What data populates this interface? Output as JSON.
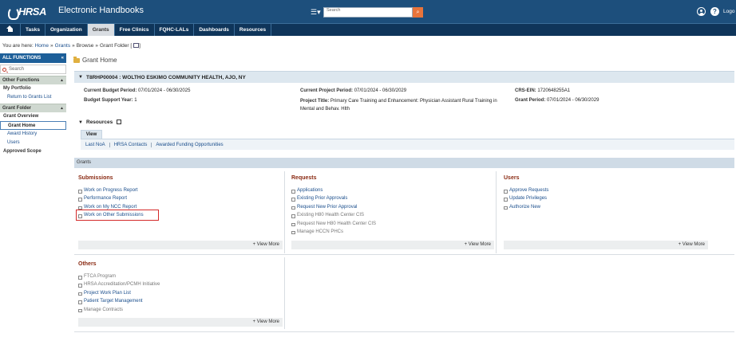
{
  "header": {
    "logo_text": "HRSA",
    "app_title": "Electronic Handbooks",
    "search_placeholder": "Search",
    "logout_label": "Logo"
  },
  "nav": {
    "items": [
      {
        "label": "Tasks"
      },
      {
        "label": "Organization"
      },
      {
        "label": "Grants",
        "active": true
      },
      {
        "label": "Free Clinics"
      },
      {
        "label": "FQHC-LALs"
      },
      {
        "label": "Dashboards"
      },
      {
        "label": "Resources"
      }
    ]
  },
  "breadcrumb": {
    "prefix": "You are here:",
    "items": [
      "Home",
      "Grants",
      "Browse",
      "Grant Folder"
    ],
    "open_bracket": "[",
    "close_bracket": "]"
  },
  "sidebar": {
    "title": "ALL FUNCTIONS",
    "collapse": "«",
    "search_placeholder": "Search",
    "sections": [
      {
        "title": "Other Functions"
      },
      {
        "title": "Grant Folder"
      }
    ],
    "my_portfolio": "My Portfolio",
    "return_link": "Return to Grants List",
    "grant_overview": "Grant Overview",
    "grant_home": "Grant Home",
    "award_history": "Award History",
    "users": "Users",
    "approved_scope": "Approved Scope"
  },
  "main": {
    "page_title": "Grant Home",
    "grant_header": "T8RHP00004 : WOLTHO ESKIMO COMMUNITY HEALTH, AJO, NY",
    "info": {
      "current_budget_period_label": "Current Budget Period:",
      "current_budget_period": "07/01/2024 - 06/30/2025",
      "budget_support_year_label": "Budget Support Year:",
      "budget_support_year": "1",
      "current_project_period_label": "Current Project Period:",
      "current_project_period": "07/01/2024 - 06/30/2029",
      "project_title_label": "Project Title:",
      "project_title_line1": "Primary Care Training and Enhancement: Physician Assistant Rural Training in",
      "project_title_line2": "Mental and Behav. Hlth",
      "crs_ein_label": "CRS-EIN:",
      "crs_ein": "1720648255A1",
      "grant_period_label": "Grant Period:",
      "grant_period": "07/01/2024 - 06/30/2029"
    },
    "resources": {
      "title": "Resources",
      "tab": "View",
      "links": [
        "Last NoA",
        "HRSA Contacts",
        "Awarded Funding Opportunities"
      ]
    },
    "grants_bar": "Grants",
    "submissions": {
      "title": "Submissions",
      "items": [
        "Work on Progress Report",
        "Performance Report",
        "Work on My NCC Report",
        "Work on Other Submissions"
      ],
      "view_more": "+ View More"
    },
    "requests": {
      "title": "Requests",
      "items": [
        {
          "label": "Applications",
          "enabled": true
        },
        {
          "label": "Existing Prior Approvals",
          "enabled": true
        },
        {
          "label": "Request New Prior Approval",
          "enabled": true
        },
        {
          "label": "Existing H80 Health Center CIS",
          "enabled": false
        },
        {
          "label": "Request New H80 Health Center CIS",
          "enabled": false
        },
        {
          "label": "Manage HCCN PHCs",
          "enabled": false
        }
      ],
      "view_more": "+ View More"
    },
    "users": {
      "title": "Users",
      "items": [
        "Approve Requests",
        "Update Privileges",
        "Authorize New"
      ],
      "view_more": "+ View More"
    },
    "others": {
      "title": "Others",
      "items": [
        {
          "label": "FTCA Program",
          "enabled": false
        },
        {
          "label": "HRSA Accreditation/PCMH Initiative",
          "enabled": false
        },
        {
          "label": "Project Work Plan List",
          "enabled": true
        },
        {
          "label": "Patient Target Management",
          "enabled": true
        },
        {
          "label": "Manage Contracts",
          "enabled": false
        }
      ],
      "view_more": "+ View More"
    }
  },
  "colors": {
    "header_bg": "#1d4f7c",
    "nav_bg": "#0f355a",
    "section_title": "#8a2a12",
    "link": "#1a4e8c",
    "highlight": "#d42a2a"
  }
}
